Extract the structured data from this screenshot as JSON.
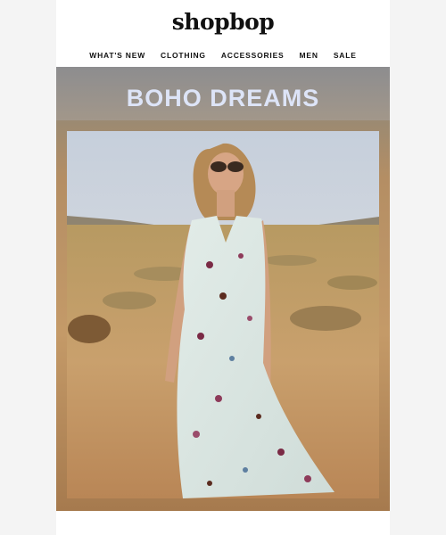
{
  "brand": {
    "logo_text": "shopbop"
  },
  "nav": {
    "items": [
      {
        "label": "WHAT'S NEW"
      },
      {
        "label": "CLOTHING"
      },
      {
        "label": "ACCESSORIES"
      },
      {
        "label": "MEN"
      },
      {
        "label": "SALE"
      }
    ]
  },
  "hero": {
    "title": "BOHO DREAMS",
    "image_subject": "model-in-floral-maxi-dress-desert",
    "title_color": "#dde4f7"
  },
  "colors": {
    "page_background": "#f4f4f4",
    "email_background": "#ffffff",
    "text": "#111111"
  }
}
